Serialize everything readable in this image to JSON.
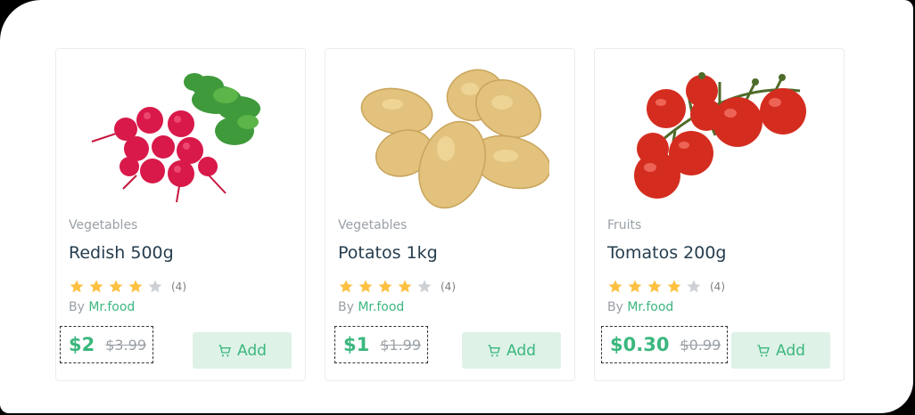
{
  "colors": {
    "accent": "#3bb77e",
    "star": "#fdc040",
    "star_empty": "#cdd1d5"
  },
  "products": [
    {
      "category": "Vegetables",
      "title": "Redish 500g",
      "rating_stars": 4,
      "rating_count": "(4)",
      "vendor_prefix": "By",
      "vendor": "Mr.food",
      "price": "$2",
      "old_price": "$3.99",
      "add_label": "Add",
      "image_icon": "radish-image"
    },
    {
      "category": "Vegetables",
      "title": "Potatos 1kg",
      "rating_stars": 4,
      "rating_count": "(4)",
      "vendor_prefix": "By",
      "vendor": "Mr.food",
      "price": "$1",
      "old_price": "$1.99",
      "add_label": "Add",
      "image_icon": "potato-image"
    },
    {
      "category": "Fruits",
      "title": "Tomatos 200g",
      "rating_stars": 4,
      "rating_count": "(4)",
      "vendor_prefix": "By",
      "vendor": "Mr.food",
      "price": "$0.30",
      "old_price": "$0.99",
      "add_label": "Add",
      "image_icon": "tomato-image"
    }
  ]
}
